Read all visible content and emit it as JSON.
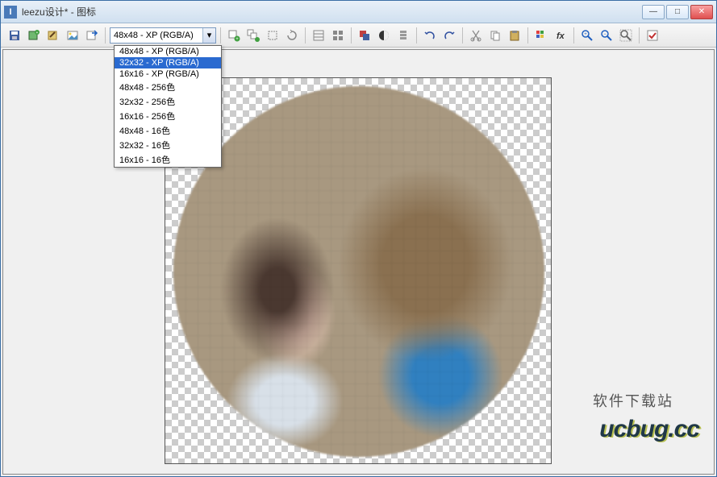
{
  "window": {
    "title": "leezu设计* - 图标",
    "min_label": "—",
    "max_label": "□",
    "close_label": "✕"
  },
  "toolbar": {
    "size_dropdown": {
      "selected": "48x48 - XP (RGB/A)",
      "options": [
        "48x48 - XP (RGB/A)",
        "32x32 - XP (RGB/A)",
        "16x16 - XP (RGB/A)",
        "48x48 - 256色",
        "32x32 - 256色",
        "16x16 - 256色",
        "48x48 - 16色",
        "32x32 - 16色",
        "16x16 - 16色"
      ],
      "highlighted_index": 1
    }
  },
  "watermark": {
    "line1": "软件下载站",
    "line2": "ucbug.cc"
  },
  "colors": {
    "titlebar_bg": "#d0e0f0",
    "highlight": "#2a6ad0",
    "close_btn": "#e05050"
  }
}
